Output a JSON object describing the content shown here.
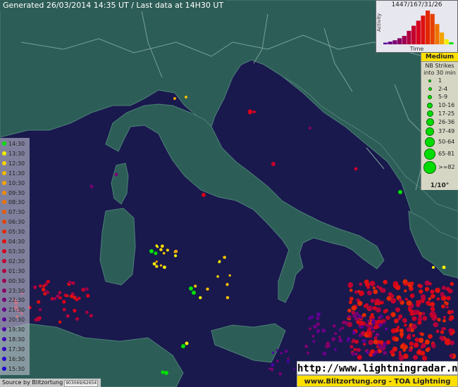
{
  "header": {
    "generated_text": "Generated 26/03/2014 14:35 UT / Last data at 14H30 UT"
  },
  "activity_chart": {
    "counts_text": "1447/167/31/26",
    "y_label": "Activity",
    "x_label": "Time",
    "bar_levels": [
      0.05,
      0.08,
      0.12,
      0.18,
      0.25,
      0.4,
      0.55,
      0.7,
      0.85,
      1.0,
      0.9,
      0.6,
      0.35,
      0.15,
      0.06
    ]
  },
  "legend": {
    "title": "Medium",
    "subtitle_1": "NB Strikes",
    "subtitle_2": "into 30 min",
    "ranges": [
      "1",
      "2-4",
      "5-9",
      "10-16",
      "17-25",
      "26-36",
      "37-49",
      "50-64",
      "65-81",
      ">=82"
    ],
    "scale": "1/10°",
    "dot_color": "#00dc00"
  },
  "time_scale": {
    "times": [
      "14:30",
      "13:30",
      "12:30",
      "11:30",
      "10:30",
      "09:30",
      "08:30",
      "07:30",
      "06:30",
      "05:30",
      "04:30",
      "03:30",
      "02:30",
      "01:30",
      "00:30",
      "23:30",
      "22:30",
      "21:30",
      "20:30",
      "19:30",
      "18:30",
      "17:30",
      "16:30",
      "15:30"
    ],
    "colors": [
      "#00e000",
      "#f2ee00",
      "#f6d400",
      "#f4bc00",
      "#f4a400",
      "#f18a00",
      "#ee7300",
      "#ea5a00",
      "#e64000",
      "#e22800",
      "#de1010",
      "#d4001e",
      "#c4002e",
      "#b0003e",
      "#9c0050",
      "#880062",
      "#780074",
      "#680086",
      "#5a0098",
      "#4c00a8",
      "#3e00b6",
      "#3200c2",
      "#2600cc",
      "#1c00d4"
    ]
  },
  "source": {
    "text": "Source by Blitzortung",
    "code": "903069/62654"
  },
  "website": {
    "url": "http://www.lightningradar.net",
    "footer": "www.Blitzortung.org - TOA Lightning Location"
  }
}
